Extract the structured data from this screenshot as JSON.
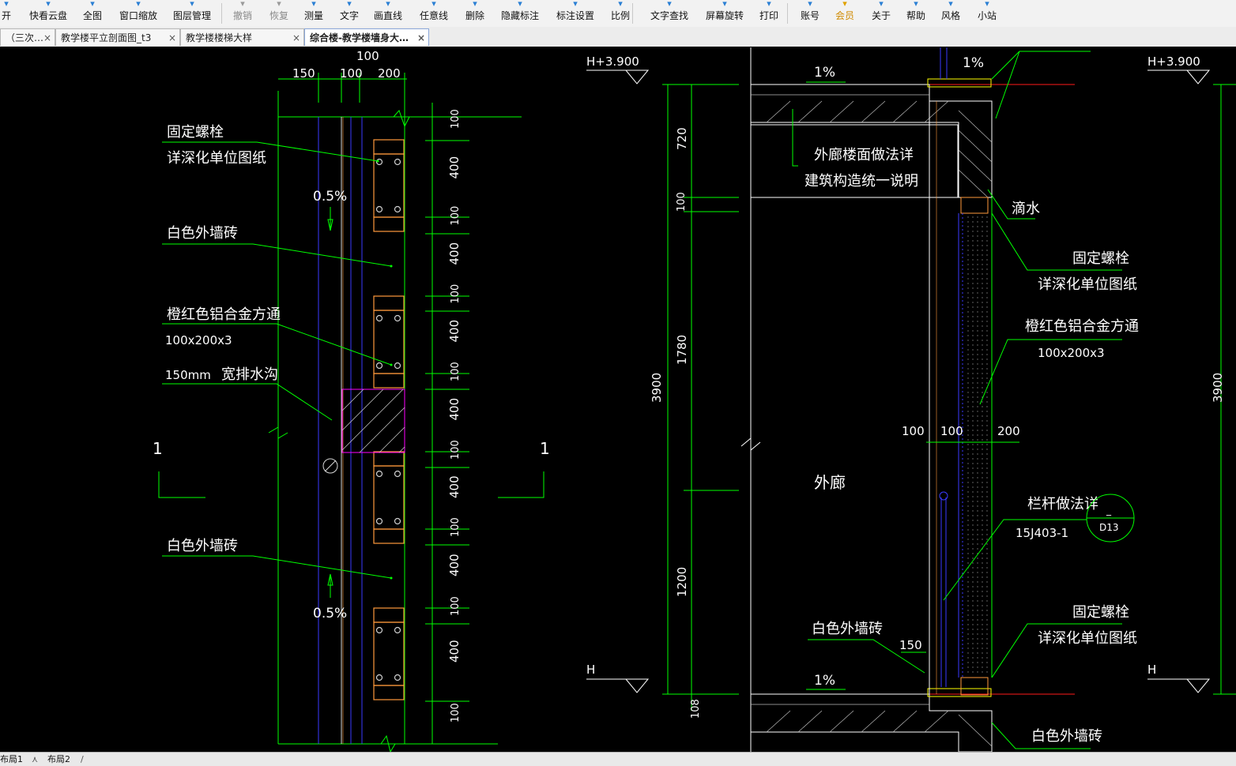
{
  "toolbar": {
    "items": [
      {
        "label": "开",
        "icon": "open-icon"
      },
      {
        "label": "快看云盘",
        "icon": "cloud-icon"
      },
      {
        "label": "全图",
        "icon": "fit-view-icon"
      },
      {
        "label": "窗口缩放",
        "icon": "window-zoom-icon"
      },
      {
        "label": "图层管理",
        "icon": "layers-icon"
      },
      {
        "label": "撤销",
        "icon": "undo-icon"
      },
      {
        "label": "恢复",
        "icon": "redo-icon"
      },
      {
        "label": "测量",
        "icon": "measure-icon"
      },
      {
        "label": "文字",
        "icon": "text-icon"
      },
      {
        "label": "画直线",
        "icon": "line-icon"
      },
      {
        "label": "任意线",
        "icon": "freeline-icon"
      },
      {
        "label": "删除",
        "icon": "delete-icon"
      },
      {
        "label": "隐藏标注",
        "icon": "hide-annotation-icon"
      },
      {
        "label": "标注设置",
        "icon": "annotation-settings-icon"
      },
      {
        "label": "比例",
        "icon": "scale-icon"
      },
      {
        "label": "文字查找",
        "icon": "text-search-icon"
      },
      {
        "label": "屏幕旋转",
        "icon": "rotate-screen-icon"
      },
      {
        "label": "打印",
        "icon": "print-icon"
      },
      {
        "label": "账号",
        "icon": "account-icon"
      },
      {
        "label": "会员",
        "icon": "vip-icon"
      },
      {
        "label": "关于",
        "icon": "about-icon"
      },
      {
        "label": "帮助",
        "icon": "help-icon"
      },
      {
        "label": "风格",
        "icon": "style-icon"
      },
      {
        "label": "小站",
        "icon": "station-icon"
      }
    ]
  },
  "tabs": [
    {
      "label": "（三次…",
      "close": "×"
    },
    {
      "label": "教学楼平立剖面图_t3",
      "close": "×"
    },
    {
      "label": "教学楼楼梯大样",
      "close": "×"
    },
    {
      "label": "综合楼-教学楼墙身大…",
      "close": "×",
      "active": true
    }
  ],
  "layout_tabs": [
    "布局1",
    "布局2"
  ],
  "drawing": {
    "left_detail": {
      "dim_top": [
        "150",
        "100",
        "200"
      ],
      "dim_top_center": "100",
      "label_bolt_1": "固定螺栓",
      "label_bolt_2": "详深化单位图纸",
      "slope_top": "0.5%",
      "label_tile_top": "白色外墙砖",
      "label_tube_1": "橙红色铝合金方通",
      "label_tube_2": "100x200x3",
      "label_gutter_1": "150mm",
      "label_gutter_2": "宽排水沟",
      "section_mark": "1",
      "label_tile_bottom": "白色外墙砖",
      "slope_bottom": "0.5%",
      "right_dims": [
        "100",
        "400",
        "100",
        "400",
        "100",
        "400",
        "100",
        "400",
        "100",
        "400",
        "100",
        "400",
        "100",
        "400",
        "100"
      ]
    },
    "right_detail": {
      "elevation_top": "H+3.900",
      "elevation_bottom": "H",
      "slope": "1%",
      "label_floor_1": "外廊楼面做法详",
      "label_floor_2": "建筑构造统一说明",
      "label_drip": "滴水",
      "label_bolt_1": "固定螺栓",
      "label_bolt_2": "详深化单位图纸",
      "label_tube_1": "橙红色铝合金方通",
      "label_tube_2": "100x200x3",
      "dims_vertical": [
        "720",
        "100",
        "1780",
        "1200",
        "3900",
        "108"
      ],
      "dims_horizontal": [
        "100",
        "100",
        "200"
      ],
      "label_corridor": "外廊",
      "label_rail_1": "栏杆做法详",
      "label_rail_2": "15J403-1",
      "detail_ref_top": "_",
      "detail_ref_bottom": "D13",
      "label_tile": "白色外墙砖",
      "dim_150": "150",
      "right_dim_total": "3900"
    }
  },
  "colors": {
    "canvas_bg": "#000000",
    "green": "#00ff00",
    "blue": "#3a3aff",
    "red": "#ff1a1a",
    "orange": "#ff9a3c",
    "yellow": "#ffff00",
    "white": "#ffffff",
    "magenta": "#ff00ff",
    "cyan": "#00c0c0"
  }
}
